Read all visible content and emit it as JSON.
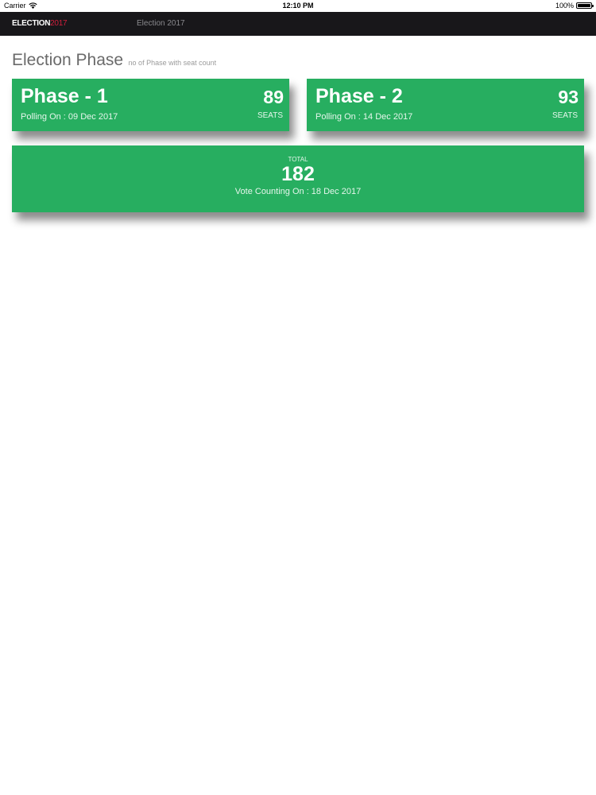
{
  "status_bar": {
    "carrier": "Carrier",
    "time": "12:10 PM",
    "battery": "100%"
  },
  "nav": {
    "logo_word": "ELECTION",
    "logo_year": "2017",
    "title": "Election 2017"
  },
  "section": {
    "title": "Election Phase",
    "subtitle": "no of Phase with seat count"
  },
  "phases": [
    {
      "name": "Phase - 1",
      "date": "Polling On : 09 Dec 2017",
      "seats": "89",
      "seats_label": "SEATS"
    },
    {
      "name": "Phase - 2",
      "date": "Polling On : 14 Dec 2017",
      "seats": "93",
      "seats_label": "SEATS"
    }
  ],
  "total": {
    "label": "TOTAL",
    "value": "182",
    "date": "Vote Counting On : 18 Dec 2017"
  },
  "colors": {
    "card_green": "#27ae60",
    "nav_bg": "#18171a",
    "logo_accent": "#d21f3c"
  }
}
